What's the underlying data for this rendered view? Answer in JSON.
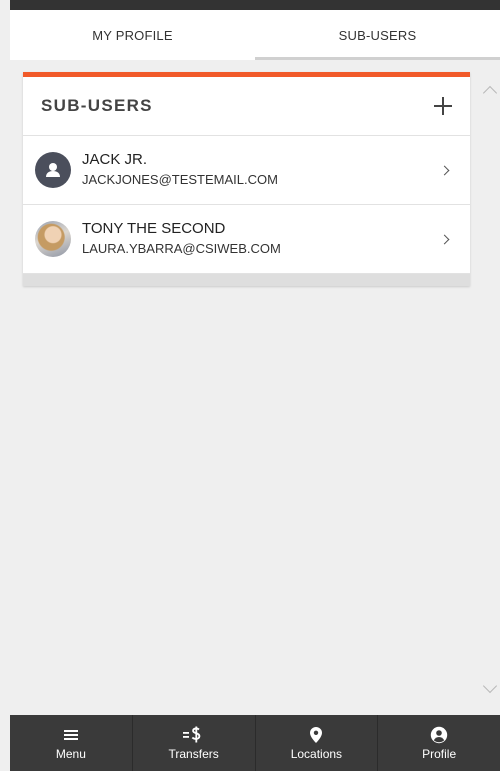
{
  "tabs": [
    {
      "label": "MY PROFILE",
      "active": false
    },
    {
      "label": "SUB-USERS",
      "active": true
    }
  ],
  "card": {
    "title": "SUB-USERS",
    "accent_color": "#f15a29",
    "add_icon": "plus-icon"
  },
  "users": [
    {
      "name": "JACK JR.",
      "email": "JACKJONES@TESTEMAIL.COM",
      "avatar": "default-user-icon"
    },
    {
      "name": "TONY THE SECOND",
      "email": "LAURA.YBARRA@CSIWEB.COM",
      "avatar": "photo"
    }
  ],
  "bottom_nav": [
    {
      "label": "Menu",
      "icon": "hamburger-icon"
    },
    {
      "label": "Transfers",
      "icon": "transfer-dollar-icon"
    },
    {
      "label": "Locations",
      "icon": "location-pin-icon"
    },
    {
      "label": "Profile",
      "icon": "profile-icon"
    }
  ]
}
